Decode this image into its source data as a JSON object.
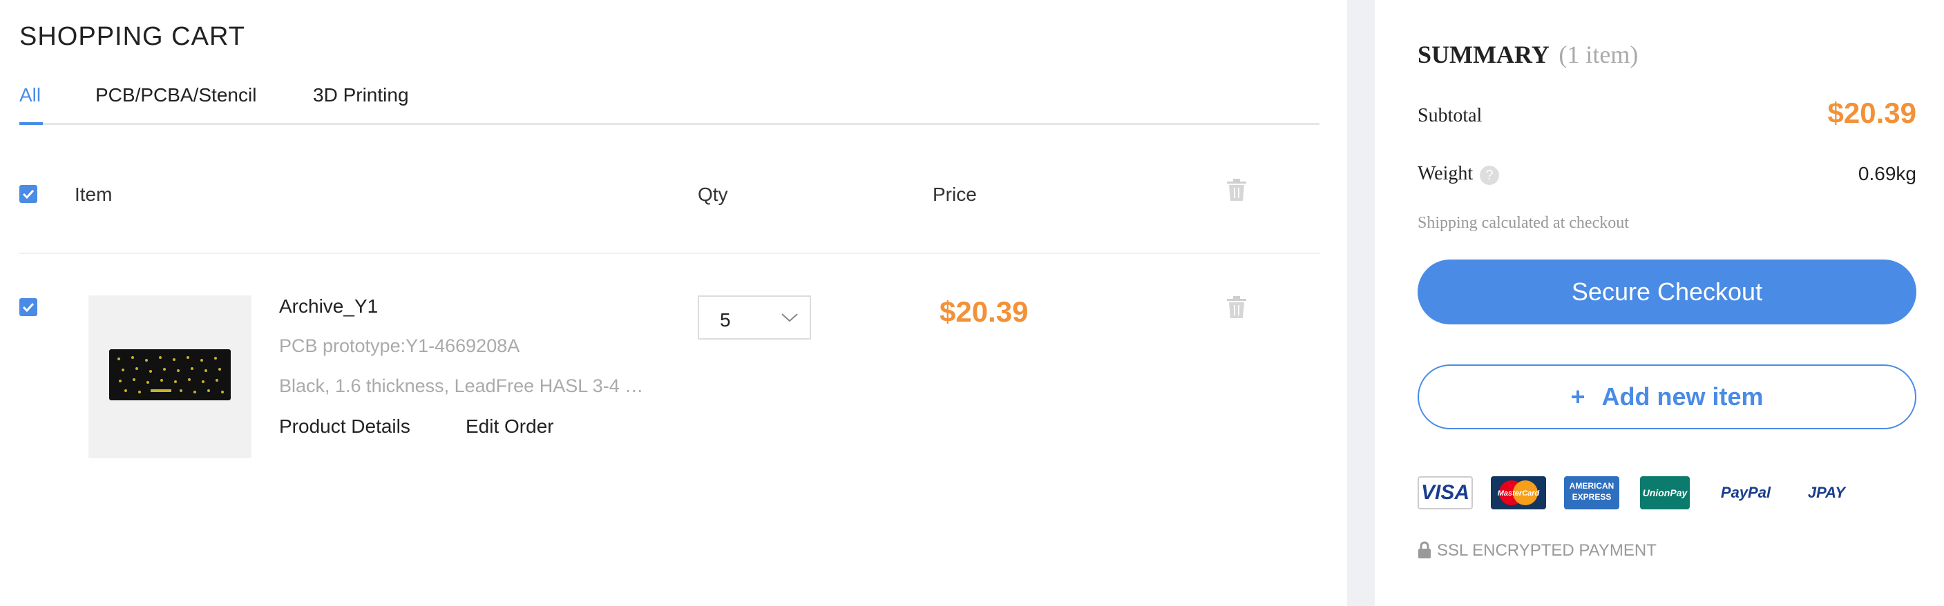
{
  "cart": {
    "title": "SHOPPING CART",
    "tabs": [
      {
        "label": "All",
        "active": true
      },
      {
        "label": "PCB/PCBA/Stencil",
        "active": false
      },
      {
        "label": "3D Printing",
        "active": false
      }
    ],
    "columns": {
      "item": "Item",
      "qty": "Qty",
      "price": "Price"
    },
    "items": [
      {
        "name": "Archive_Y1",
        "subtitle": "PCB prototype:Y1-4669208A",
        "description": "Black, 1.6 thickness, LeadFree HASL 3-4 …",
        "qty": "5",
        "price": "$20.39",
        "links": {
          "details": "Product Details",
          "edit": "Edit Order"
        }
      }
    ]
  },
  "summary": {
    "title": "SUMMARY",
    "count": "(1 item)",
    "subtotal_label": "Subtotal",
    "subtotal_value": "$20.39",
    "weight_label": "Weight",
    "weight_help": "?",
    "weight_value": "0.69kg",
    "shipping_note": "Shipping calculated at checkout",
    "checkout_label": "Secure Checkout",
    "add_item_plus": "+",
    "add_item_label": "Add new item",
    "payments": {
      "visa": "VISA",
      "mastercard": "MasterCard",
      "amex_line1": "AMERICAN",
      "amex_line2": "EXPRESS",
      "unionpay": "UnionPay",
      "paypal": "PayPal",
      "jpay": "JPAY"
    },
    "ssl_label": "SSL ENCRYPTED PAYMENT"
  },
  "colors": {
    "accent": "#4a8be6",
    "price": "#f39138",
    "muted": "#aaaaaa",
    "gutter": "#eef0f4"
  },
  "icons": [
    "checkbox-check-icon",
    "trash-icon",
    "chevron-down-icon",
    "help-icon",
    "lock-icon"
  ]
}
